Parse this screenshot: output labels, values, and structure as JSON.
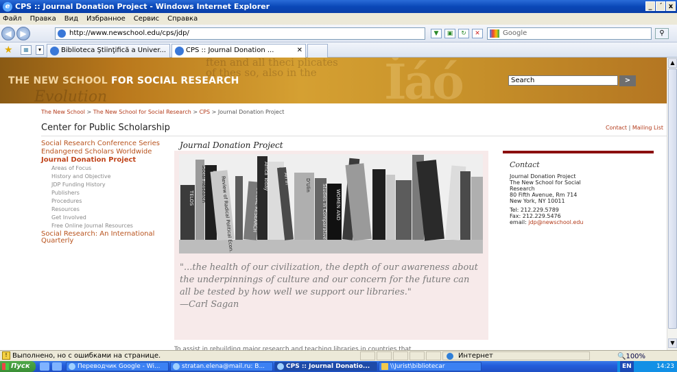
{
  "window": {
    "title": "CPS :: Journal Donation Project - Windows Internet Explorer",
    "controls": [
      "_",
      "´",
      "x"
    ]
  },
  "menu": [
    "Файл",
    "Правка",
    "Вид",
    "Избранное",
    "Сервис",
    "Справка"
  ],
  "address": {
    "url": "http://www.newschool.edu/cps/jdp/",
    "search_placeholder": "Google"
  },
  "tabs": [
    {
      "label": "Biblioteca Ştiinţifică a Univer..."
    },
    {
      "label": "CPS :: Journal Donation ..."
    }
  ],
  "banner": {
    "brand_a": "THE NEW SCHOOL",
    "brand_b": " FOR SOCIAL RESEARCH",
    "search_value": "Search",
    "search_go": ">",
    "bg_text": "ften and all theci plicates of thes so, also in the",
    "deco": "İáó",
    "script": "Evolution"
  },
  "breadcrumb": {
    "items": [
      "The New School",
      "The New School for Social Research",
      "CPS"
    ],
    "current": "Journal Donation Project",
    "sep": " > "
  },
  "page_title": "Center for Public Scholarship",
  "top_links": {
    "contact": "Contact",
    "sep": " | ",
    "mailing": "Mailing List"
  },
  "leftnav": {
    "conference": "Social Research Conference Series",
    "endangered": "Endangered Scholars Worldwide",
    "jdp": "Journal Donation Project",
    "subs": [
      "Areas of Focus",
      "History and Objective",
      "JDP Funding History",
      "Publishers",
      "Procedures",
      "Resources",
      "Get Involved",
      "Free Online Journal Resources"
    ],
    "quarterly": "Social Research: An International Quarterly"
  },
  "content": {
    "title": "Journal Donation Project",
    "quote": "\"...the health of our civilization, the depth of our awareness about the underpinnings of culture and our concern for the future can all be tested by how well we support our libraries.\"",
    "author": "—Carl Sagan",
    "below": "To assist in rebuilding major research and teaching libraries in countries that"
  },
  "contact": {
    "heading": "Contact",
    "lines": [
      "Journal Donation Project",
      "The New School for Social",
      "Research",
      "80 Fifth Avenue, Rm 714",
      "New York, NY 10011"
    ],
    "tel": "Tel: 212.229.5789",
    "fax": "Fax: 212.229.5476",
    "email_label": "email: ",
    "email": "jdp@newschool.edu"
  },
  "status": {
    "message": "Выполнено, но с ошибками на странице.",
    "zone": "Интернет",
    "zoom": "100%"
  },
  "taskbar": {
    "start": "Пуск",
    "tasks": [
      "Переводчик Google - Wi...",
      "stratan.elena@mail.ru: B...",
      "CPS :: Journal Donatio...",
      "\\\\Jurist\\bibliotecar"
    ],
    "lang": "EN",
    "time": "14:23"
  },
  "photo_spines": [
    "TELOS",
    "Social Research",
    "Feminist",
    "Review of Radical Political Econ.",
    "African Today",
    "SOCIAL RESEARCH",
    "Africa Today",
    "UPTI",
    "An In",
    "D'Ulin",
    "Studies in Comparative",
    "WOMEN AND"
  ]
}
